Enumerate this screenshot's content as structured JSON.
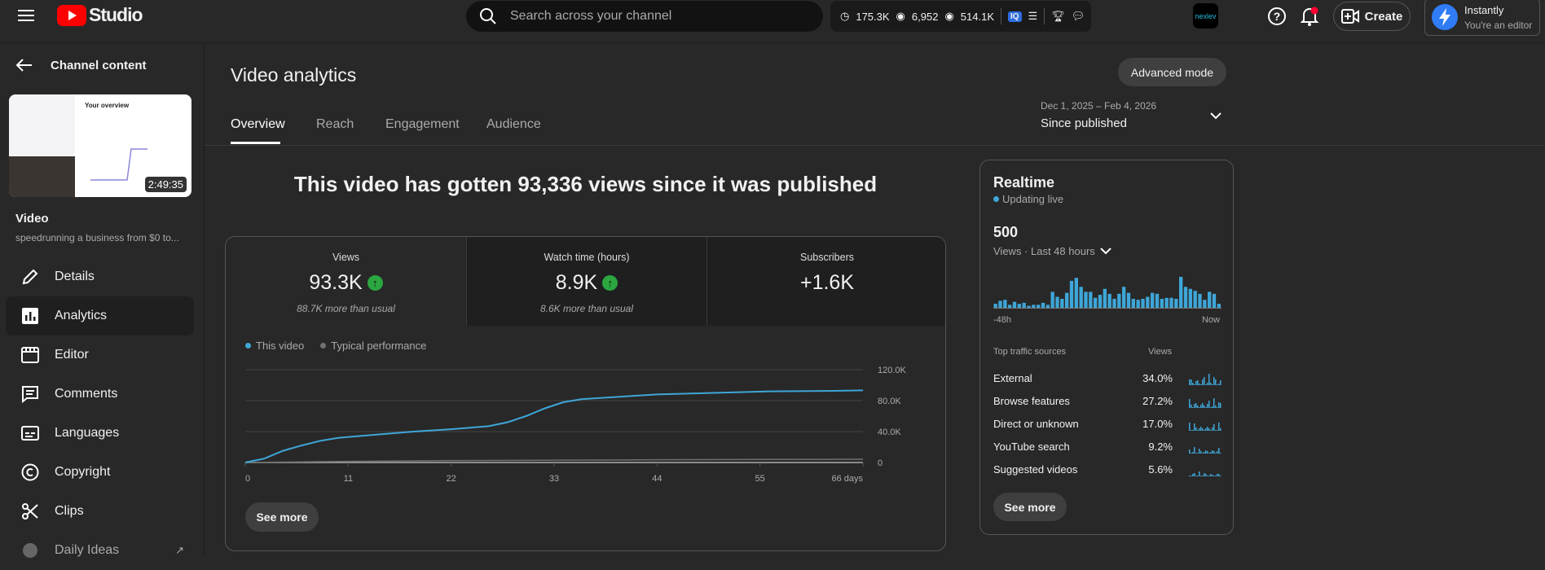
{
  "topbar": {
    "logo_text": "Studio",
    "search_placeholder": "Search across your channel",
    "stats": {
      "watch_hours": "175.3K",
      "views_a": "6,952",
      "views_b": "514.1K"
    },
    "create_label": "Create",
    "account": {
      "name": "Instantly",
      "role": "You're an editor"
    },
    "extension_logo_text": "nexlev"
  },
  "sidebar": {
    "back_label": "Channel content",
    "thumbnail": {
      "duration": "2:49:35",
      "screen_title": "Your overview"
    },
    "video_label": "Video",
    "video_title": "speedrunning a business from $0 to...",
    "items": [
      {
        "label": "Details",
        "icon": "pencil-icon"
      },
      {
        "label": "Analytics",
        "icon": "analytics-icon",
        "active": true
      },
      {
        "label": "Editor",
        "icon": "editor-icon"
      },
      {
        "label": "Comments",
        "icon": "comments-icon"
      },
      {
        "label": "Languages",
        "icon": "subtitles-icon"
      },
      {
        "label": "Copyright",
        "icon": "copyright-icon"
      },
      {
        "label": "Clips",
        "icon": "scissors-icon"
      },
      {
        "label": "Daily Ideas",
        "icon": "ideas-icon"
      }
    ]
  },
  "main": {
    "title": "Video analytics",
    "advanced_mode": "Advanced mode",
    "tabs": [
      {
        "label": "Overview",
        "active": true
      },
      {
        "label": "Reach"
      },
      {
        "label": "Engagement"
      },
      {
        "label": "Audience"
      }
    ],
    "date_range": {
      "dates": "Dec 1, 2025 – Feb 4, 2026",
      "label": "Since published"
    },
    "headline": "This video has gotten 93,336 views since it was published",
    "metrics": [
      {
        "label": "Views",
        "value": "93.3K",
        "note": "88.7K more than usual",
        "trend": "up"
      },
      {
        "label": "Watch time (hours)",
        "value": "8.9K",
        "note": "8.6K more than usual",
        "trend": "up"
      },
      {
        "label": "Subscribers",
        "value": "+1.6K"
      }
    ],
    "see_more": "See more"
  },
  "chart_data": [
    {
      "type": "line",
      "legend": [
        "This video",
        "Typical performance"
      ],
      "legend_placement": "top-left",
      "colors": [
        "#3ea6d8",
        "#717171"
      ],
      "xlabel": "",
      "ylabel": "",
      "x_ticks": [
        "0",
        "11",
        "22",
        "33",
        "44",
        "55",
        "66 days"
      ],
      "y_ticks": [
        "0",
        "40.0K",
        "80.0K",
        "120.0K"
      ],
      "xlim": [
        0,
        66
      ],
      "ylim": [
        0,
        120000
      ],
      "grid": true,
      "series": [
        {
          "name": "This video",
          "x": [
            0,
            2,
            4,
            6,
            8,
            10,
            14,
            18,
            22,
            24,
            26,
            28,
            30,
            32,
            34,
            36,
            40,
            44,
            50,
            56,
            62,
            66
          ],
          "y": [
            0,
            5000,
            15000,
            22000,
            28000,
            32000,
            36000,
            40000,
            43000,
            45000,
            47000,
            52000,
            60000,
            70000,
            78000,
            82000,
            85000,
            88000,
            90000,
            92000,
            92500,
            93300
          ]
        },
        {
          "name": "Typical performance",
          "x": [
            0,
            11,
            22,
            33,
            44,
            55,
            66
          ],
          "y": [
            0,
            1500,
            2500,
            3000,
            3500,
            4000,
            4200
          ]
        }
      ]
    },
    {
      "type": "bar",
      "title": "Realtime",
      "status": "Updating live",
      "total": "500",
      "metric_label": "Views · Last 48 hours",
      "x_labels": [
        "-48h",
        "Now"
      ],
      "color": "#3ea6d8",
      "values": [
        4,
        7,
        8,
        3,
        6,
        4,
        5,
        2,
        3,
        3,
        5,
        3,
        16,
        11,
        9,
        15,
        27,
        30,
        21,
        16,
        16,
        10,
        13,
        19,
        14,
        9,
        14,
        21,
        15,
        9,
        8,
        9,
        11,
        15,
        14,
        9,
        10,
        10,
        9,
        31,
        21,
        19,
        17,
        14,
        8,
        16,
        14,
        4
      ]
    }
  ],
  "realtime": {
    "title": "Realtime",
    "status": "Updating live",
    "total": "500",
    "metric_label": "Views · Last 48 hours",
    "x_start": "-48h",
    "x_end": "Now",
    "sources_header": "Top traffic sources",
    "views_header": "Views",
    "sources": [
      {
        "name": "External",
        "pct": "34.0%"
      },
      {
        "name": "Browse features",
        "pct": "27.2%"
      },
      {
        "name": "Direct or unknown",
        "pct": "17.0%"
      },
      {
        "name": "YouTube search",
        "pct": "9.2%"
      },
      {
        "name": "Suggested videos",
        "pct": "5.6%"
      }
    ],
    "see_more": "See more"
  }
}
